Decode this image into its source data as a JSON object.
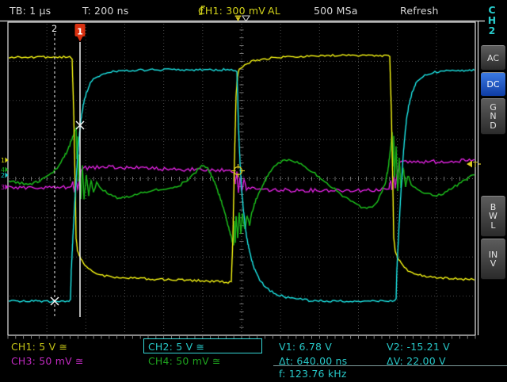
{
  "top_bar": {
    "timebase": "TB: 1 μs",
    "trigger_time": "T: 200 ns",
    "trigger_channel": "CH1: 300 mV",
    "trigger_mode": "AL",
    "sample_rate": "500 MSa",
    "run_mode": "Refresh"
  },
  "right_menu": {
    "title": "CH2",
    "buttons": [
      {
        "label": "AC",
        "selected": false
      },
      {
        "label": "DC",
        "selected": true
      },
      {
        "label": "GND",
        "selected": false
      },
      {
        "label": "BWL",
        "selected": false
      },
      {
        "label": "INV",
        "selected": false
      }
    ]
  },
  "bottom_bar": {
    "ch1_label": "CH1: 5 V ≅",
    "ch3_label": "CH3: 50 mV ≅",
    "ch2_label": "CH2: 5 V ≅",
    "ch4_label": "CH4: 50 mV ≅",
    "v1": "V1: 6.78 V",
    "v2": "V2: -15.21 V",
    "dt": "Δt: 640.00 ns",
    "dv": "ΔV: 22.00 V",
    "freq": "f: 123.76 kHz"
  },
  "colors": {
    "ch1": "#d8d810",
    "ch2": "#18c8c8",
    "ch3": "#d020d0",
    "ch4": "#18a818",
    "cursor": "#ededed",
    "flag_red": "#d93010",
    "trigger_yellow": "#d8c820",
    "grid": "#484848",
    "frame": "#e0e0e0",
    "select_blue": "#1c55c8"
  },
  "chart_data": {
    "type": "line",
    "title": "oscilloscope waveform display, 12x8 divisions, 1 us/div",
    "grid": {
      "area": [
        10,
        28,
        600,
        423
      ],
      "cols": 12,
      "rows": 8
    },
    "series": [
      {
        "name": "CH3",
        "scale": "50 mV/div",
        "color": "#d020d0",
        "fuzz": 2.3,
        "width": 1.2,
        "seed": 7,
        "points": [
          [
            10,
            237
          ],
          [
            40,
            237
          ],
          [
            70,
            236
          ],
          [
            88,
            236
          ],
          [
            92,
            230
          ],
          [
            94,
            243
          ],
          [
            96,
            226
          ],
          [
            98,
            240
          ],
          [
            100,
            228
          ],
          [
            103,
            213
          ],
          [
            115,
            211
          ],
          [
            140,
            211
          ],
          [
            170,
            212
          ],
          [
            200,
            213
          ],
          [
            230,
            214
          ],
          [
            260,
            214
          ],
          [
            285,
            215
          ],
          [
            295,
            216
          ],
          [
            297,
            232
          ],
          [
            299,
            218
          ],
          [
            301,
            242
          ],
          [
            303,
            224
          ],
          [
            305,
            240
          ],
          [
            308,
            228
          ],
          [
            311,
            238
          ],
          [
            316,
            237
          ],
          [
            330,
            239
          ],
          [
            350,
            240
          ],
          [
            380,
            240
          ],
          [
            410,
            240
          ],
          [
            440,
            240
          ],
          [
            465,
            240
          ],
          [
            485,
            239
          ],
          [
            491,
            238
          ],
          [
            493,
            228
          ],
          [
            495,
            240
          ],
          [
            497,
            222
          ],
          [
            499,
            236
          ],
          [
            501,
            220
          ],
          [
            504,
            206
          ],
          [
            515,
            204
          ],
          [
            530,
            204
          ],
          [
            550,
            204
          ],
          [
            575,
            203
          ],
          [
            600,
            203
          ]
        ]
      },
      {
        "name": "CH4",
        "scale": "50 mV/div",
        "color": "#18a818",
        "fuzz": 1.6,
        "width": 1.4,
        "seed": 13,
        "points": [
          [
            10,
            227
          ],
          [
            25,
            231
          ],
          [
            38,
            232
          ],
          [
            50,
            229
          ],
          [
            62,
            222
          ],
          [
            72,
            212
          ],
          [
            80,
            200
          ],
          [
            86,
            188
          ],
          [
            91,
            175
          ],
          [
            94,
            166
          ],
          [
            96,
            163
          ],
          [
            97,
            200
          ],
          [
            98,
            172
          ],
          [
            99,
            230
          ],
          [
            100,
            195
          ],
          [
            102,
            252
          ],
          [
            104,
            210
          ],
          [
            106,
            250
          ],
          [
            109,
            222
          ],
          [
            112,
            246
          ],
          [
            115,
            228
          ],
          [
            118,
            242
          ],
          [
            122,
            231
          ],
          [
            127,
            238
          ],
          [
            133,
            242
          ],
          [
            140,
            246
          ],
          [
            148,
            250
          ],
          [
            155,
            250
          ],
          [
            165,
            247
          ],
          [
            178,
            243
          ],
          [
            192,
            240
          ],
          [
            205,
            238
          ],
          [
            218,
            236
          ],
          [
            228,
            233
          ],
          [
            237,
            227
          ],
          [
            245,
            219
          ],
          [
            252,
            212
          ],
          [
            257,
            208
          ],
          [
            262,
            212
          ],
          [
            267,
            222
          ],
          [
            272,
            233
          ],
          [
            277,
            247
          ],
          [
            282,
            262
          ],
          [
            286,
            277
          ],
          [
            290,
            292
          ],
          [
            293,
            303
          ],
          [
            295,
            308
          ],
          [
            296,
            280
          ],
          [
            297,
            305
          ],
          [
            298,
            272
          ],
          [
            300,
            300
          ],
          [
            302,
            268
          ],
          [
            304,
            295
          ],
          [
            306,
            270
          ],
          [
            309,
            290
          ],
          [
            312,
            272
          ],
          [
            315,
            283
          ],
          [
            318,
            268
          ],
          [
            322,
            255
          ],
          [
            330,
            237
          ],
          [
            338,
            222
          ],
          [
            346,
            211
          ],
          [
            354,
            204
          ],
          [
            362,
            202
          ],
          [
            370,
            203
          ],
          [
            380,
            208
          ],
          [
            390,
            214
          ],
          [
            400,
            221
          ],
          [
            410,
            229
          ],
          [
            420,
            237
          ],
          [
            430,
            245
          ],
          [
            440,
            252
          ],
          [
            448,
            257
          ],
          [
            456,
            261
          ],
          [
            463,
            262
          ],
          [
            470,
            260
          ],
          [
            476,
            254
          ],
          [
            482,
            243
          ],
          [
            487,
            228
          ],
          [
            490,
            212
          ],
          [
            492,
            196
          ],
          [
            494,
            178
          ],
          [
            495,
            168
          ],
          [
            496,
            210
          ],
          [
            497,
            172
          ],
          [
            498,
            225
          ],
          [
            500,
            185
          ],
          [
            502,
            240
          ],
          [
            504,
            200
          ],
          [
            506,
            238
          ],
          [
            509,
            212
          ],
          [
            512,
            235
          ],
          [
            515,
            222
          ],
          [
            519,
            232
          ],
          [
            524,
            237
          ],
          [
            530,
            240
          ],
          [
            538,
            244
          ],
          [
            546,
            247
          ],
          [
            554,
            246
          ],
          [
            562,
            243
          ],
          [
            572,
            237
          ],
          [
            582,
            230
          ],
          [
            592,
            224
          ],
          [
            600,
            220
          ]
        ]
      },
      {
        "name": "CH1",
        "scale": "5 V/div",
        "color": "#d8d810",
        "fuzz": 1.3,
        "width": 1.3,
        "seed": 3,
        "points": [
          [
            10,
            72
          ],
          [
            50,
            72
          ],
          [
            88,
            72
          ],
          [
            91,
            74
          ],
          [
            93,
            140
          ],
          [
            95,
            240
          ],
          [
            96,
            300
          ],
          [
            98,
            318
          ],
          [
            102,
            327
          ],
          [
            107,
            335
          ],
          [
            114,
            341
          ],
          [
            122,
            345
          ],
          [
            132,
            348
          ],
          [
            145,
            350
          ],
          [
            165,
            351
          ],
          [
            190,
            352
          ],
          [
            220,
            353
          ],
          [
            248,
            354
          ],
          [
            270,
            355
          ],
          [
            288,
            356
          ],
          [
            292,
            354
          ],
          [
            294,
            300
          ],
          [
            296,
            200
          ],
          [
            298,
            120
          ],
          [
            300,
            95
          ],
          [
            302,
            88
          ],
          [
            306,
            84
          ],
          [
            312,
            80
          ],
          [
            320,
            77
          ],
          [
            332,
            75
          ],
          [
            345,
            73
          ],
          [
            360,
            72
          ],
          [
            380,
            71
          ],
          [
            410,
            70
          ],
          [
            450,
            70
          ],
          [
            490,
            70
          ],
          [
            492,
            72
          ],
          [
            494,
            140
          ],
          [
            496,
            240
          ],
          [
            497,
            300
          ],
          [
            499,
            318
          ],
          [
            503,
            327
          ],
          [
            508,
            335
          ],
          [
            515,
            341
          ],
          [
            523,
            345
          ],
          [
            533,
            348
          ],
          [
            546,
            350
          ],
          [
            562,
            351
          ],
          [
            580,
            352
          ],
          [
            600,
            353
          ]
        ]
      },
      {
        "name": "CH2",
        "scale": "5 V/div",
        "color": "#18c8c8",
        "fuzz": 1.3,
        "width": 1.3,
        "seed": 5,
        "points": [
          [
            10,
            380
          ],
          [
            40,
            380
          ],
          [
            70,
            380
          ],
          [
            87,
            380
          ],
          [
            89,
            377
          ],
          [
            90,
            340
          ],
          [
            92,
            300
          ],
          [
            94,
            262
          ],
          [
            96,
            228
          ],
          [
            98,
            196
          ],
          [
            100,
            172
          ],
          [
            102,
            152
          ],
          [
            105,
            133
          ],
          [
            109,
            117
          ],
          [
            114,
            105
          ],
          [
            120,
            98
          ],
          [
            128,
            94
          ],
          [
            138,
            91
          ],
          [
            150,
            90
          ],
          [
            165,
            89
          ],
          [
            190,
            88
          ],
          [
            230,
            88
          ],
          [
            270,
            88
          ],
          [
            297,
            88
          ],
          [
            299,
            90
          ],
          [
            300,
            120
          ],
          [
            301,
            160
          ],
          [
            303,
            205
          ],
          [
            305,
            240
          ],
          [
            308,
            272
          ],
          [
            311,
            297
          ],
          [
            315,
            318
          ],
          [
            320,
            336
          ],
          [
            326,
            350
          ],
          [
            333,
            360
          ],
          [
            341,
            367
          ],
          [
            350,
            372
          ],
          [
            361,
            375
          ],
          [
            374,
            377
          ],
          [
            390,
            379
          ],
          [
            420,
            380
          ],
          [
            460,
            380
          ],
          [
            498,
            380
          ],
          [
            500,
            377
          ],
          [
            501,
            340
          ],
          [
            503,
            300
          ],
          [
            505,
            262
          ],
          [
            507,
            228
          ],
          [
            509,
            196
          ],
          [
            511,
            172
          ],
          [
            513,
            152
          ],
          [
            516,
            133
          ],
          [
            520,
            117
          ],
          [
            525,
            105
          ],
          [
            531,
            98
          ],
          [
            539,
            94
          ],
          [
            549,
            91
          ],
          [
            561,
            90
          ],
          [
            576,
            89
          ],
          [
            600,
            88
          ]
        ]
      }
    ],
    "cursors": [
      {
        "id": "cursor-2",
        "x": 69,
        "style": "dashed",
        "label": "2",
        "flag": false,
        "line": [
          42,
          400
        ],
        "marker": [
          69,
          380
        ]
      },
      {
        "id": "cursor-1",
        "x": 101,
        "style": "solid",
        "label": "1",
        "flag": true,
        "line": [
          53,
          400
        ],
        "marker": [
          101,
          158
        ]
      }
    ],
    "trigger": {
      "time_marker_x": 300.5,
      "ref_marker_x": 310.5,
      "level_marker": {
        "x": 596,
        "y": 207,
        "label": "T"
      },
      "point": [
        300.5,
        215.5
      ]
    },
    "channel_markers": [
      {
        "label": "1",
        "y": 202,
        "color": "#d8d810"
      },
      {
        "label": "4",
        "y": 214,
        "color": "#18a818"
      },
      {
        "label": "2",
        "y": 221,
        "color": "#18c8c8"
      },
      {
        "label": "3",
        "y": 236,
        "color": "#d020d0"
      }
    ]
  }
}
